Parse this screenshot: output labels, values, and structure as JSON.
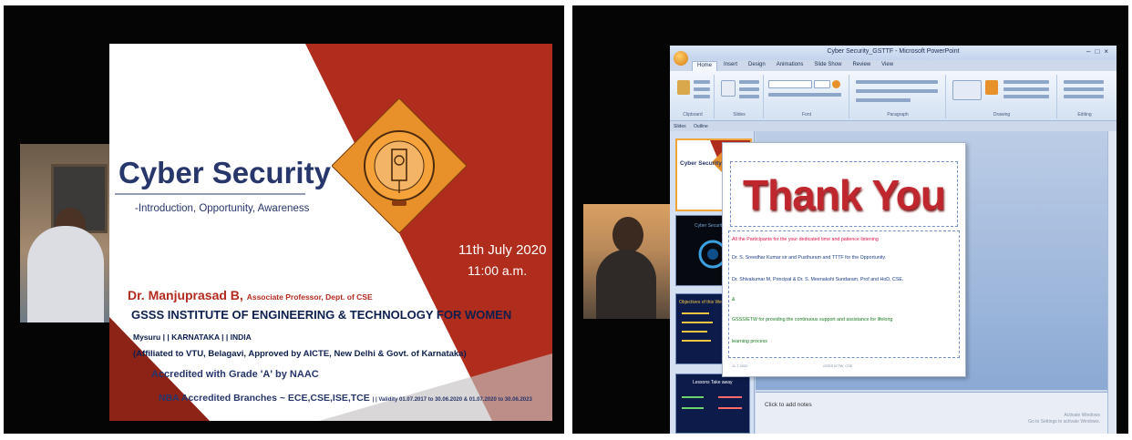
{
  "left_slide": {
    "title": "Cyber Security",
    "subtitle": "-Introduction, Opportunity, Awareness",
    "date": "11th July 2020",
    "time": "11:00 a.m.",
    "presenter": "Dr. Manjuprasad B,",
    "presenter_role": "Associate Professor, Dept. of CSE",
    "institute": "GSSS INSTITUTE OF ENGINEERING & TECHNOLOGY FOR WOMEN",
    "location": "Mysuru | | KARNATAKA | | INDIA",
    "affiliation": "(Affiliated to VTU, Belagavi, Approved by AICTE, New Delhi & Govt. of Karnataka)",
    "accreditation": "Accredited with Grade 'A' by NAAC",
    "nba": "NBA Accredited Branches ~ ECE,CSE,ISE,TCE",
    "nba_validity": "| | Validity 01.07.2017 to 30.06.2020 & 01.07.2020 to 30.06.2023",
    "colors": {
      "accent_red": "#b42a1f",
      "navy": "#27366b",
      "logo_orange": "#e8902a"
    }
  },
  "powerpoint": {
    "window_title": "Cyber Security_GSTTF - Microsoft PowerPoint",
    "ribbon_tabs": [
      "Home",
      "Insert",
      "Design",
      "Animations",
      "Slide Show",
      "Review",
      "View"
    ],
    "ribbon_groups": [
      "Clipboard",
      "Slides",
      "Font",
      "Paragraph",
      "Drawing",
      "Editing"
    ],
    "side_tabs": [
      "Slides",
      "Outline"
    ],
    "thumbnails": [
      {
        "title": "Cyber Security"
      },
      {
        "title": "Cyber Security"
      },
      {
        "title": "Objectives of this Webinar Series"
      },
      {
        "title": "Lessons Take away"
      }
    ],
    "slide": {
      "heading": "Thank You",
      "lines": [
        "All the Participants for the your dedicated time and patience listening",
        "Dr. S. Sreedhar Kumar sir and Pusthuram and TTTF for the Opportunity.",
        "Dr. Shivakumar M, Principal & Dr. S. Meenakshi Sundaram, Prof and HoD, CSE.",
        "&",
        "GSSSIETW for providing the continuous support and assistance for lifelong",
        "learning process"
      ],
      "footer_left": "11.7.2020",
      "footer_mid": "GSSS IETW, CSE"
    },
    "notes_placeholder": "Click to add notes",
    "watermark": "Activate Windows\nGo to Settings to activate Windows."
  }
}
